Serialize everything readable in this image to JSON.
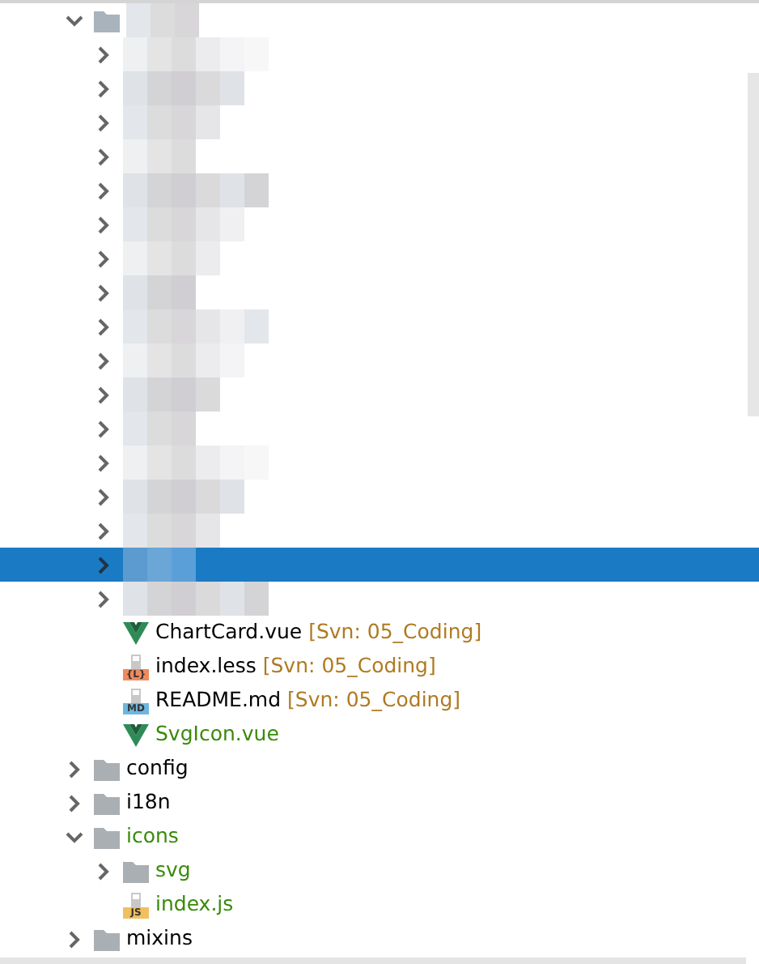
{
  "tree": [
    {
      "kind": "redacted",
      "expanded": true,
      "selected": false,
      "children": [
        {
          "kind": "redacted",
          "expanded": false,
          "selected": false
        },
        {
          "kind": "redacted",
          "expanded": false,
          "selected": false
        },
        {
          "kind": "redacted",
          "expanded": false,
          "selected": false
        },
        {
          "kind": "redacted",
          "expanded": false,
          "selected": false
        },
        {
          "kind": "redacted",
          "expanded": false,
          "selected": false
        },
        {
          "kind": "redacted",
          "expanded": false,
          "selected": false
        },
        {
          "kind": "redacted",
          "expanded": false,
          "selected": false
        },
        {
          "kind": "redacted",
          "expanded": false,
          "selected": false
        },
        {
          "kind": "redacted",
          "expanded": false,
          "selected": false
        },
        {
          "kind": "redacted",
          "expanded": false,
          "selected": false
        },
        {
          "kind": "redacted",
          "expanded": false,
          "selected": false
        },
        {
          "kind": "redacted",
          "expanded": false,
          "selected": false
        },
        {
          "kind": "redacted",
          "expanded": false,
          "selected": false
        },
        {
          "kind": "redacted",
          "expanded": false,
          "selected": false
        },
        {
          "kind": "redacted",
          "expanded": false,
          "selected": false
        },
        {
          "kind": "redacted",
          "expanded": false,
          "selected": true
        },
        {
          "kind": "redacted",
          "expanded": false,
          "selected": false
        },
        {
          "kind": "vue",
          "label": "ChartCard.vue",
          "tag": "[Svn: 05_Coding]",
          "vcs_added": false,
          "selected": false
        },
        {
          "kind": "less",
          "icon_text": "{L}",
          "label": "index.less",
          "tag": "[Svn: 05_Coding]",
          "vcs_added": false,
          "selected": false
        },
        {
          "kind": "md",
          "icon_text": "MD",
          "label": "README.md",
          "tag": "[Svn: 05_Coding]",
          "vcs_added": false,
          "selected": false
        },
        {
          "kind": "vue",
          "label": "SvgIcon.vue",
          "vcs_added": true,
          "selected": false
        }
      ]
    },
    {
      "kind": "folder",
      "label": "config",
      "expanded": false,
      "vcs_added": false,
      "selected": false
    },
    {
      "kind": "folder",
      "label": "i18n",
      "expanded": false,
      "vcs_added": false,
      "selected": false
    },
    {
      "kind": "folder",
      "label": "icons",
      "expanded": true,
      "vcs_added": true,
      "selected": false,
      "children": [
        {
          "kind": "folder",
          "label": "svg",
          "expanded": false,
          "vcs_added": true,
          "selected": false
        },
        {
          "kind": "js",
          "icon_text": "JS",
          "label": "index.js",
          "vcs_added": true,
          "selected": false
        }
      ]
    },
    {
      "kind": "folder",
      "label": "mixins",
      "expanded": false,
      "vcs_added": false,
      "selected": false
    }
  ]
}
